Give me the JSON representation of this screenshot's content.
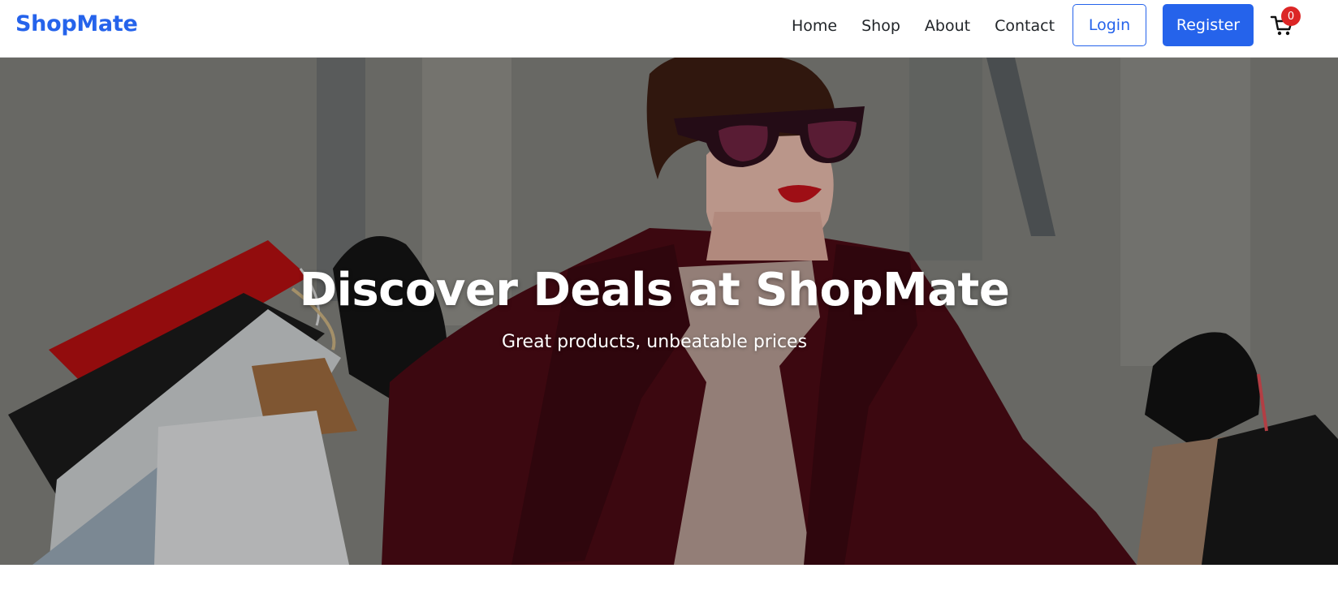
{
  "navbar": {
    "brand": "ShopMate",
    "links": [
      "Home",
      "Shop",
      "About",
      "Contact"
    ],
    "login_label": "Login",
    "register_label": "Register",
    "cart_count": "0",
    "cart_icon": "cart-icon"
  },
  "hero": {
    "title": "Discover Deals at ShopMate",
    "subtitle": "Great products, unbeatable prices",
    "image": "woman-with-shopping-bags-photo"
  },
  "colors": {
    "brand": "#2563eb",
    "badge": "#dc2626"
  }
}
